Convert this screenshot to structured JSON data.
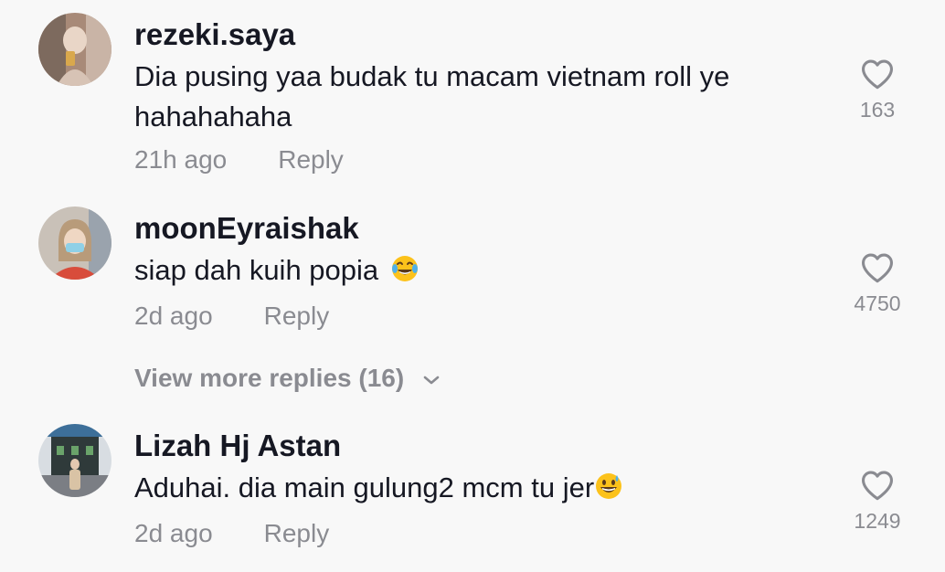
{
  "comments": [
    {
      "username": "rezeki.saya",
      "text": "Dia pusing yaa budak tu macam vietnam roll ye hahahahaha",
      "time": "21h ago",
      "reply": "Reply",
      "likes": "163",
      "avatar": "user-photo"
    },
    {
      "username": "moonEyraishak",
      "text": "siap dah kuih popia",
      "emoji": "😂",
      "time": "2d ago",
      "reply": "Reply",
      "likes": "4750",
      "avatar": "user-photo",
      "view_more": "View more replies (16)"
    },
    {
      "username": "Lizah Hj Astan",
      "text": "Aduhai. dia main gulung2 mcm tu jer",
      "emoji": "😅",
      "time": "2d ago",
      "reply": "Reply",
      "likes": "1249",
      "avatar": "user-photo"
    }
  ],
  "icons": {
    "like": "heart-outline-icon",
    "expand": "chevron-down-icon"
  },
  "colors": {
    "background": "#f8f8f8",
    "text": "#161823",
    "secondary": "#8a8b91"
  }
}
